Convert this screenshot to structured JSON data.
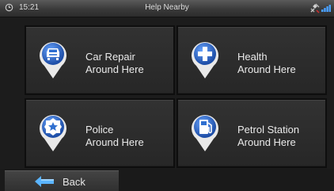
{
  "status": {
    "time": "15:21",
    "title": "Help Nearby",
    "clock_icon": "clock-icon",
    "gps_icon": "satellite-icon",
    "signal_icon": "signal-icon"
  },
  "tiles": [
    {
      "label": "Car Repair\nAround Here",
      "icon": "car-repair-icon",
      "accent": "#2f6fd0"
    },
    {
      "label": "Health\nAround Here",
      "icon": "health-cross-icon",
      "accent": "#2f6fd0"
    },
    {
      "label": "Police\nAround Here",
      "icon": "police-badge-icon",
      "accent": "#2f6fd0"
    },
    {
      "label": "Petrol Station\nAround Here",
      "icon": "fuel-pump-icon",
      "accent": "#2f6fd0"
    }
  ],
  "footer": {
    "back_label": "Back",
    "back_icon": "back-arrow-icon",
    "back_icon_color": "#5ab4ff"
  }
}
